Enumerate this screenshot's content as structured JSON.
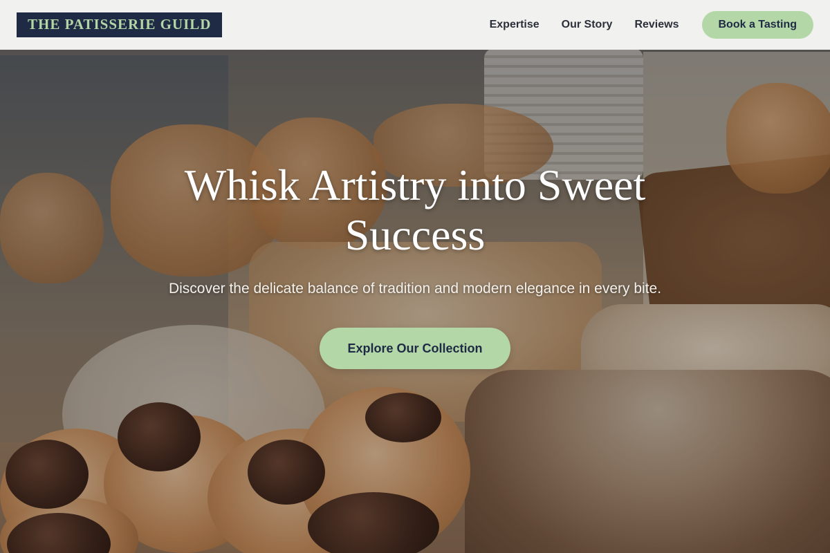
{
  "header": {
    "logo_text": "THE PATISSERIE GUILD",
    "nav": [
      {
        "label": "Expertise"
      },
      {
        "label": "Our Story"
      },
      {
        "label": "Reviews"
      }
    ],
    "cta_label": "Book a Tasting"
  },
  "hero": {
    "title": "Whisk Artistry into Sweet Success",
    "subtitle": "Discover the delicate balance of tradition and modern elegance in every bite.",
    "button_label": "Explore Our Collection"
  },
  "colors": {
    "brand_navy": "#1f2b45",
    "accent_green": "#b4d7a8",
    "header_bg": "#fafaf9"
  }
}
